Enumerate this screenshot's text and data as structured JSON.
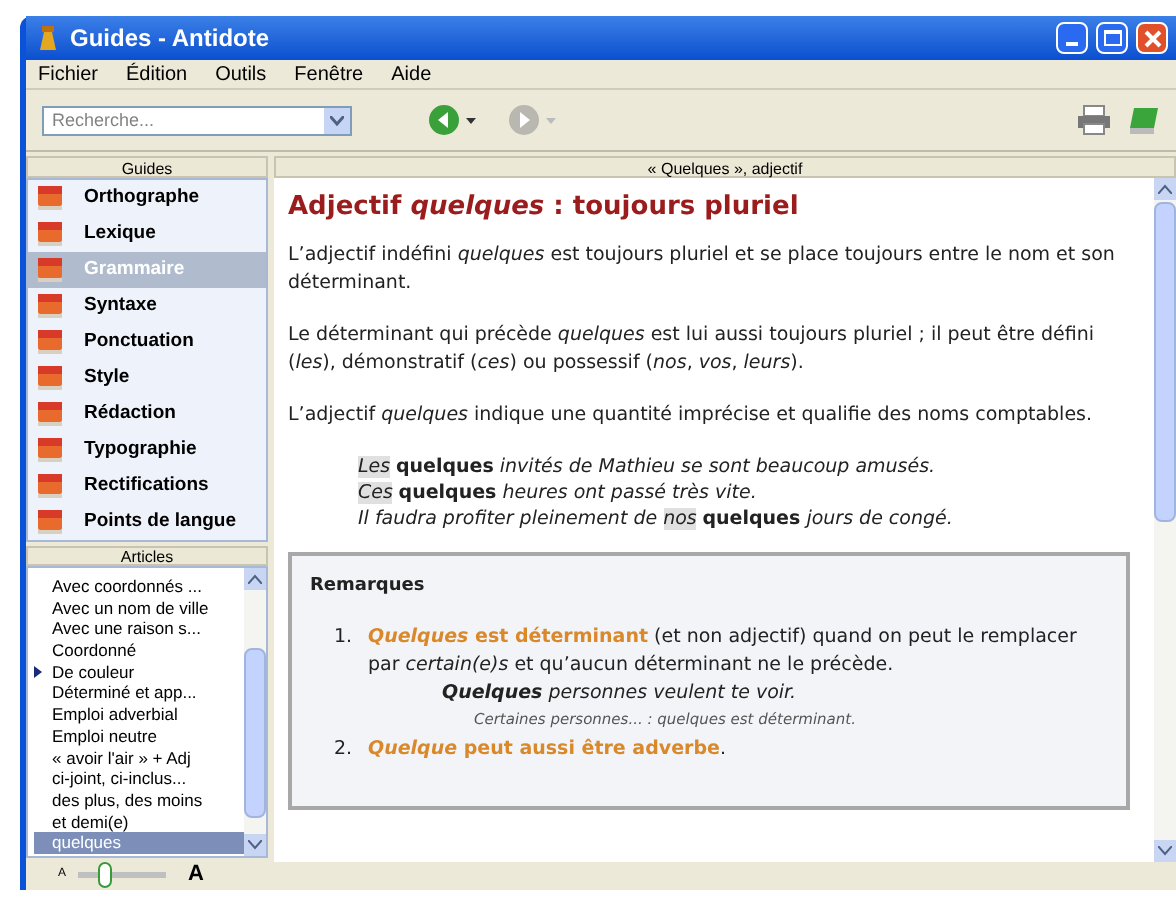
{
  "window": {
    "title": "Guides - Antidote"
  },
  "menu": [
    "Fichier",
    "Édition",
    "Outils",
    "Fenêtre",
    "Aide"
  ],
  "toolbar": {
    "search": {
      "placeholder": "Recherche..."
    },
    "back_enabled": true,
    "forward_enabled": false
  },
  "guides": {
    "header": "Guides",
    "items": [
      {
        "label": "Orthographe",
        "selected": false
      },
      {
        "label": "Lexique",
        "selected": false
      },
      {
        "label": "Grammaire",
        "selected": true
      },
      {
        "label": "Syntaxe",
        "selected": false
      },
      {
        "label": "Ponctuation",
        "selected": false
      },
      {
        "label": "Style",
        "selected": false
      },
      {
        "label": "Rédaction",
        "selected": false
      },
      {
        "label": "Typographie",
        "selected": false
      },
      {
        "label": "Rectifications",
        "selected": false
      },
      {
        "label": "Points de langue",
        "selected": false
      }
    ]
  },
  "articles": {
    "header": "Articles",
    "items": [
      {
        "label": "Avec coordonnés ...",
        "selected": false,
        "marked": false
      },
      {
        "label": "Avec un nom de ville",
        "selected": false,
        "marked": false
      },
      {
        "label": "Avec une raison s...",
        "selected": false,
        "marked": false
      },
      {
        "label": "Coordonné",
        "selected": false,
        "marked": false
      },
      {
        "label": "De couleur",
        "selected": false,
        "marked": true
      },
      {
        "label": "Déterminé et app...",
        "selected": false,
        "marked": false
      },
      {
        "label": "Emploi adverbial",
        "selected": false,
        "marked": false
      },
      {
        "label": "Emploi neutre",
        "selected": false,
        "marked": false
      },
      {
        "label": "« avoir l'air » + Adj",
        "selected": false,
        "marked": false
      },
      {
        "label": "ci-joint, ci-inclus...",
        "selected": false,
        "marked": false
      },
      {
        "label": "des plus, des moins",
        "selected": false,
        "marked": false
      },
      {
        "label": "et demi(e)",
        "selected": false,
        "marked": false
      },
      {
        "label": "quelques",
        "selected": true,
        "marked": false
      }
    ]
  },
  "font_size": {
    "small_label": "A",
    "large_label": "A",
    "level": 0.3
  },
  "content": {
    "header": "« Quelques », adjectif",
    "title": "Adjectif *quelques* : toujours pluriel",
    "paragraphs": [
      "L’adjectif indéfini *quelques* est toujours pluriel et se place toujours entre le nom et son déterminant.",
      "Le déterminant qui précède *quelques* est lui aussi toujours pluriel ; il peut être défini (*les*), démonstratif (*ces*) ou possessif (*nos*, *vos*, *leurs*).",
      "L’adjectif *quelques* indique une quantité imprécise et qualifie des noms comptables."
    ],
    "examples": [
      [
        {
          "kind": "determiner",
          "text": "Les"
        },
        {
          "kind": "key",
          "text": "quelques"
        },
        {
          "kind": "plain",
          "text": " invités de Mathieu se sont beaucoup amusés."
        }
      ],
      [
        {
          "kind": "determiner",
          "text": "Ces"
        },
        {
          "kind": "key",
          "text": "quelques"
        },
        {
          "kind": "plain",
          "text": " heures ont passé très vite."
        }
      ],
      [
        {
          "kind": "plain",
          "text": "Il faudra profiter pleinement de "
        },
        {
          "kind": "determiner",
          "text": "nos"
        },
        {
          "kind": "key",
          "text": "quelques"
        },
        {
          "kind": "plain",
          "text": " jours de congé."
        }
      ]
    ],
    "remarks": {
      "title": "Remarques",
      "items": [
        {
          "number": "1.",
          "parts": [
            {
              "kind": "key",
              "text": "*Quelques* est déterminant"
            },
            {
              "kind": "plain",
              "text": " (et non adjectif) quand on peut le remplacer par *certain(e)s* et qu’aucun déterminant ne le précède."
            }
          ],
          "example": "**Quelques** personnes veulent te voir.",
          "note": "Certaines personnes... : *quelques* est déterminant."
        },
        {
          "number": "2.",
          "parts": [
            {
              "kind": "key",
              "text": "*Quelque* peut aussi être adverbe"
            },
            {
              "kind": "plain",
              "text": "."
            }
          ]
        }
      ]
    }
  }
}
